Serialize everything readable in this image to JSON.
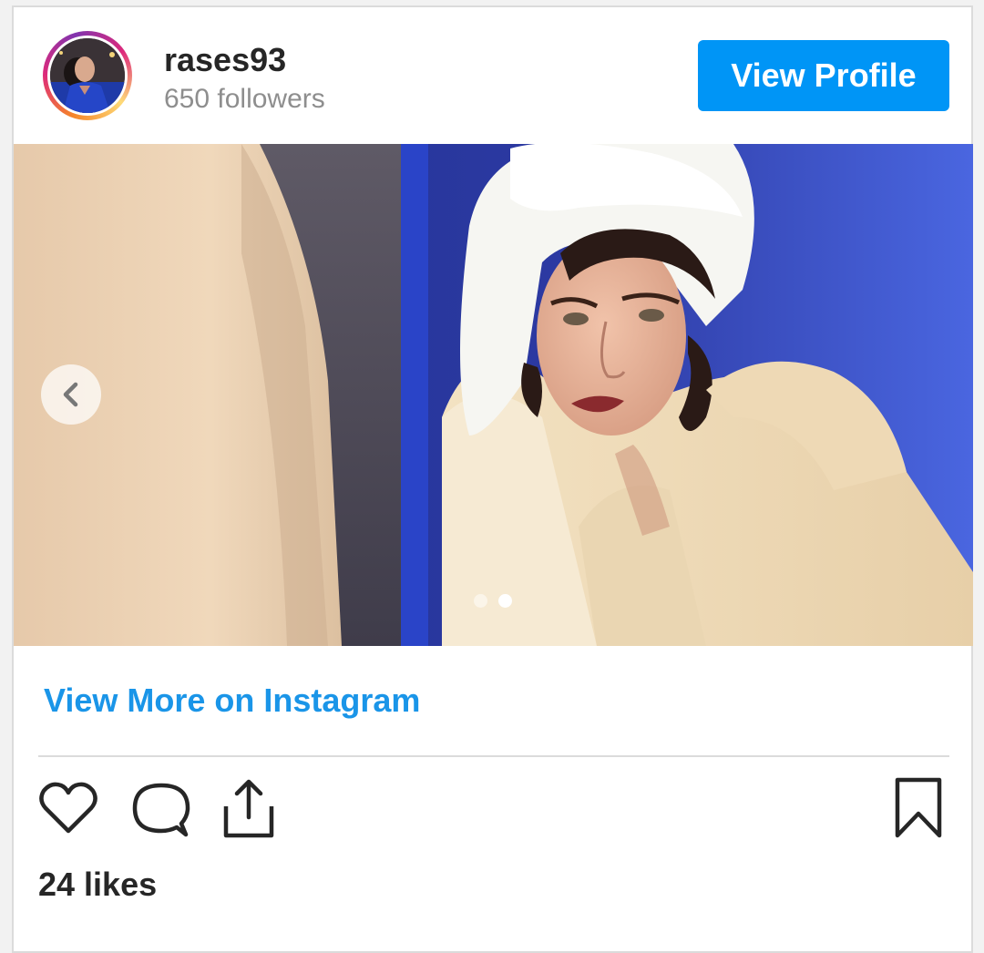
{
  "post": {
    "username": "rases93",
    "followers": "650 followers",
    "view_profile_label": "View Profile",
    "view_more_label": "View More on Instagram",
    "likes": "24 likes",
    "carousel": {
      "total_slides": 2,
      "active_slide": 2
    }
  },
  "icons": {
    "prev": "chevron-left-icon",
    "like": "heart-icon",
    "comment": "comment-bubble-icon",
    "share": "share-upload-icon",
    "save": "bookmark-icon"
  },
  "colors": {
    "accent": "#0095f6",
    "link": "#1a95e8",
    "text": "#262626",
    "muted": "#8e8e8e",
    "border": "#dbdbdb"
  }
}
